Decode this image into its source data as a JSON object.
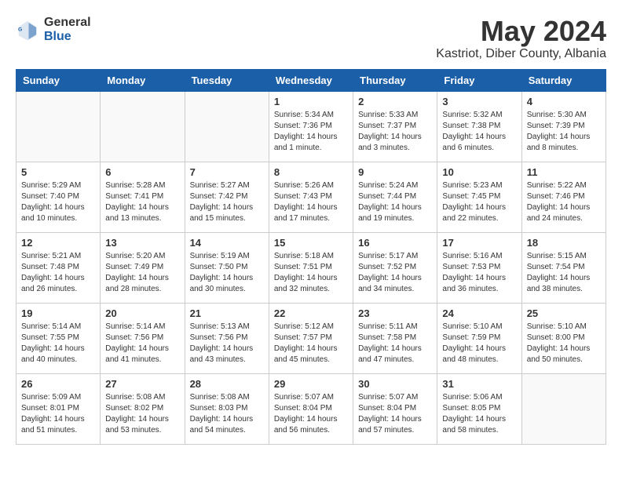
{
  "logo": {
    "general": "General",
    "blue": "Blue"
  },
  "title": {
    "month_year": "May 2024",
    "location": "Kastriot, Diber County, Albania"
  },
  "days_of_week": [
    "Sunday",
    "Monday",
    "Tuesday",
    "Wednesday",
    "Thursday",
    "Friday",
    "Saturday"
  ],
  "weeks": [
    [
      {
        "day": "",
        "info": ""
      },
      {
        "day": "",
        "info": ""
      },
      {
        "day": "",
        "info": ""
      },
      {
        "day": "1",
        "info": "Sunrise: 5:34 AM\nSunset: 7:36 PM\nDaylight: 14 hours\nand 1 minute."
      },
      {
        "day": "2",
        "info": "Sunrise: 5:33 AM\nSunset: 7:37 PM\nDaylight: 14 hours\nand 3 minutes."
      },
      {
        "day": "3",
        "info": "Sunrise: 5:32 AM\nSunset: 7:38 PM\nDaylight: 14 hours\nand 6 minutes."
      },
      {
        "day": "4",
        "info": "Sunrise: 5:30 AM\nSunset: 7:39 PM\nDaylight: 14 hours\nand 8 minutes."
      }
    ],
    [
      {
        "day": "5",
        "info": "Sunrise: 5:29 AM\nSunset: 7:40 PM\nDaylight: 14 hours\nand 10 minutes."
      },
      {
        "day": "6",
        "info": "Sunrise: 5:28 AM\nSunset: 7:41 PM\nDaylight: 14 hours\nand 13 minutes."
      },
      {
        "day": "7",
        "info": "Sunrise: 5:27 AM\nSunset: 7:42 PM\nDaylight: 14 hours\nand 15 minutes."
      },
      {
        "day": "8",
        "info": "Sunrise: 5:26 AM\nSunset: 7:43 PM\nDaylight: 14 hours\nand 17 minutes."
      },
      {
        "day": "9",
        "info": "Sunrise: 5:24 AM\nSunset: 7:44 PM\nDaylight: 14 hours\nand 19 minutes."
      },
      {
        "day": "10",
        "info": "Sunrise: 5:23 AM\nSunset: 7:45 PM\nDaylight: 14 hours\nand 22 minutes."
      },
      {
        "day": "11",
        "info": "Sunrise: 5:22 AM\nSunset: 7:46 PM\nDaylight: 14 hours\nand 24 minutes."
      }
    ],
    [
      {
        "day": "12",
        "info": "Sunrise: 5:21 AM\nSunset: 7:48 PM\nDaylight: 14 hours\nand 26 minutes."
      },
      {
        "day": "13",
        "info": "Sunrise: 5:20 AM\nSunset: 7:49 PM\nDaylight: 14 hours\nand 28 minutes."
      },
      {
        "day": "14",
        "info": "Sunrise: 5:19 AM\nSunset: 7:50 PM\nDaylight: 14 hours\nand 30 minutes."
      },
      {
        "day": "15",
        "info": "Sunrise: 5:18 AM\nSunset: 7:51 PM\nDaylight: 14 hours\nand 32 minutes."
      },
      {
        "day": "16",
        "info": "Sunrise: 5:17 AM\nSunset: 7:52 PM\nDaylight: 14 hours\nand 34 minutes."
      },
      {
        "day": "17",
        "info": "Sunrise: 5:16 AM\nSunset: 7:53 PM\nDaylight: 14 hours\nand 36 minutes."
      },
      {
        "day": "18",
        "info": "Sunrise: 5:15 AM\nSunset: 7:54 PM\nDaylight: 14 hours\nand 38 minutes."
      }
    ],
    [
      {
        "day": "19",
        "info": "Sunrise: 5:14 AM\nSunset: 7:55 PM\nDaylight: 14 hours\nand 40 minutes."
      },
      {
        "day": "20",
        "info": "Sunrise: 5:14 AM\nSunset: 7:56 PM\nDaylight: 14 hours\nand 41 minutes."
      },
      {
        "day": "21",
        "info": "Sunrise: 5:13 AM\nSunset: 7:56 PM\nDaylight: 14 hours\nand 43 minutes."
      },
      {
        "day": "22",
        "info": "Sunrise: 5:12 AM\nSunset: 7:57 PM\nDaylight: 14 hours\nand 45 minutes."
      },
      {
        "day": "23",
        "info": "Sunrise: 5:11 AM\nSunset: 7:58 PM\nDaylight: 14 hours\nand 47 minutes."
      },
      {
        "day": "24",
        "info": "Sunrise: 5:10 AM\nSunset: 7:59 PM\nDaylight: 14 hours\nand 48 minutes."
      },
      {
        "day": "25",
        "info": "Sunrise: 5:10 AM\nSunset: 8:00 PM\nDaylight: 14 hours\nand 50 minutes."
      }
    ],
    [
      {
        "day": "26",
        "info": "Sunrise: 5:09 AM\nSunset: 8:01 PM\nDaylight: 14 hours\nand 51 minutes."
      },
      {
        "day": "27",
        "info": "Sunrise: 5:08 AM\nSunset: 8:02 PM\nDaylight: 14 hours\nand 53 minutes."
      },
      {
        "day": "28",
        "info": "Sunrise: 5:08 AM\nSunset: 8:03 PM\nDaylight: 14 hours\nand 54 minutes."
      },
      {
        "day": "29",
        "info": "Sunrise: 5:07 AM\nSunset: 8:04 PM\nDaylight: 14 hours\nand 56 minutes."
      },
      {
        "day": "30",
        "info": "Sunrise: 5:07 AM\nSunset: 8:04 PM\nDaylight: 14 hours\nand 57 minutes."
      },
      {
        "day": "31",
        "info": "Sunrise: 5:06 AM\nSunset: 8:05 PM\nDaylight: 14 hours\nand 58 minutes."
      },
      {
        "day": "",
        "info": ""
      }
    ]
  ]
}
